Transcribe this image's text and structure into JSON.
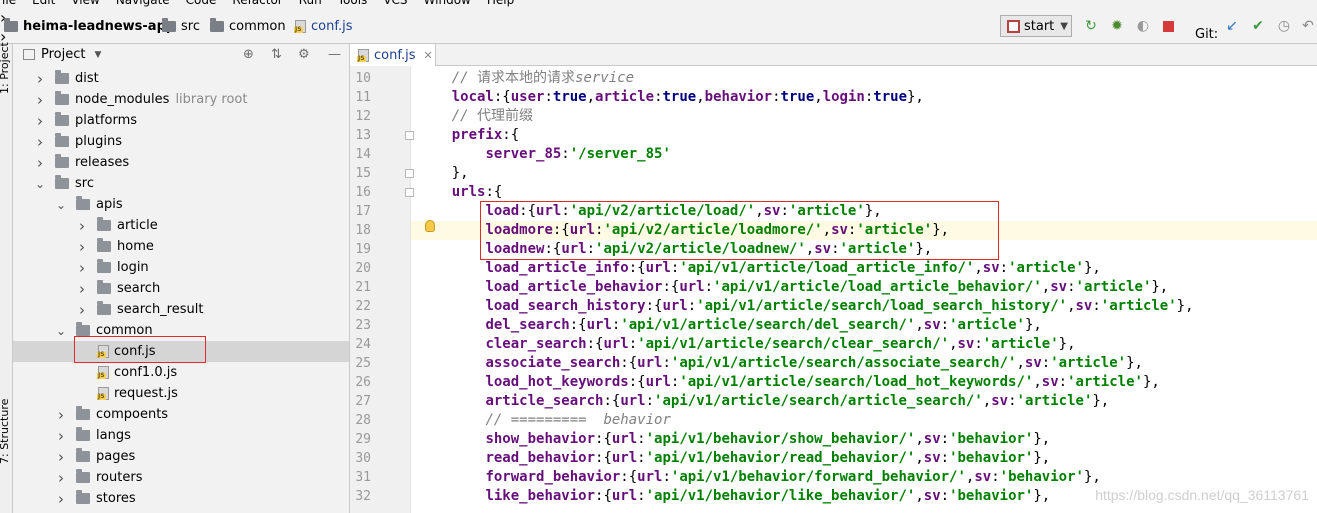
{
  "menu": [
    "File",
    "Edit",
    "View",
    "Navigate",
    "Code",
    "Refactor",
    "Run",
    "Tools",
    "VCS",
    "Window",
    "Help"
  ],
  "breadcrumb": {
    "project": "heima-leadnews-app",
    "src": "src",
    "common": "common",
    "file": "conf.js"
  },
  "toolbar": {
    "run_config": "start",
    "git_label": "Git:",
    "icons": [
      "npm-icon",
      "chevron-down-icon",
      "rerun-icon",
      "debug-icon",
      "coverage-icon",
      "stop-icon",
      "git-update-icon",
      "git-commit-icon",
      "history-icon",
      "revert-icon"
    ]
  },
  "stripe": {
    "project_label": "1: Project",
    "structure_label": "7: Structure"
  },
  "project_panel": {
    "title": "Project",
    "tree": [
      {
        "label": "dist",
        "type": "folder",
        "expanded": false
      },
      {
        "label": "node_modules",
        "hint": "library root",
        "type": "folder",
        "expanded": false
      },
      {
        "label": "platforms",
        "type": "folder",
        "expanded": false
      },
      {
        "label": "plugins",
        "type": "folder",
        "expanded": false
      },
      {
        "label": "releases",
        "type": "folder",
        "expanded": false
      },
      {
        "label": "src",
        "type": "folder",
        "expanded": true
      },
      {
        "label": "apis",
        "type": "folder",
        "expanded": true
      },
      {
        "label": "article",
        "type": "folder",
        "expanded": false
      },
      {
        "label": "home",
        "type": "folder",
        "expanded": false
      },
      {
        "label": "login",
        "type": "folder",
        "expanded": false
      },
      {
        "label": "search",
        "type": "folder",
        "expanded": false
      },
      {
        "label": "search_result",
        "type": "folder",
        "expanded": false
      },
      {
        "label": "common",
        "type": "folder",
        "expanded": true
      },
      {
        "label": "conf.js",
        "type": "file",
        "selected": true
      },
      {
        "label": "conf1.0.js",
        "type": "file"
      },
      {
        "label": "request.js",
        "type": "file"
      },
      {
        "label": "compoents",
        "type": "folder",
        "expanded": false
      },
      {
        "label": "langs",
        "type": "folder",
        "expanded": false
      },
      {
        "label": "pages",
        "type": "folder",
        "expanded": false
      },
      {
        "label": "routers",
        "type": "folder",
        "expanded": false
      },
      {
        "label": "stores",
        "type": "folder",
        "expanded": false
      }
    ]
  },
  "editor": {
    "tab": "conf.js",
    "highlighted_line": 18,
    "lines": [
      {
        "n": "10",
        "tokens": [
          [
            "cm",
            "// "
          ],
          [
            "cjk",
            "请求本地的请求"
          ],
          [
            "cm",
            "service"
          ]
        ]
      },
      {
        "n": "11",
        "tokens": [
          [
            "key",
            "local"
          ],
          [
            "p",
            ":{"
          ],
          [
            "key",
            "user"
          ],
          [
            "p",
            ":"
          ],
          [
            "kw",
            "true"
          ],
          [
            "p",
            ","
          ],
          [
            "key",
            "article"
          ],
          [
            "p",
            ":"
          ],
          [
            "kw",
            "true"
          ],
          [
            "p",
            ","
          ],
          [
            "key",
            "behavior"
          ],
          [
            "p",
            ":"
          ],
          [
            "kw",
            "true"
          ],
          [
            "p",
            ","
          ],
          [
            "key",
            "login"
          ],
          [
            "p",
            ":"
          ],
          [
            "kw",
            "true"
          ],
          [
            "p",
            "},"
          ]
        ]
      },
      {
        "n": "12",
        "tokens": [
          [
            "cm",
            "// "
          ],
          [
            "cjk",
            "代理前缀"
          ]
        ]
      },
      {
        "n": "13",
        "tokens": [
          [
            "key",
            "prefix"
          ],
          [
            "p",
            ":{"
          ]
        ]
      },
      {
        "n": "14",
        "tokens": [
          [
            "p",
            "    "
          ],
          [
            "key",
            "server_85"
          ],
          [
            "p",
            ":"
          ],
          [
            "str",
            "'/server_85'"
          ]
        ]
      },
      {
        "n": "15",
        "tokens": [
          [
            "p",
            "},"
          ]
        ]
      },
      {
        "n": "16",
        "tokens": [
          [
            "key",
            "urls"
          ],
          [
            "p",
            ":{"
          ]
        ]
      },
      {
        "n": "17",
        "tokens": [
          [
            "p",
            "    "
          ],
          [
            "key",
            "load"
          ],
          [
            "p",
            ":{"
          ],
          [
            "key",
            "url"
          ],
          [
            "p",
            ":"
          ],
          [
            "str",
            "'api/v2/article/load/'"
          ],
          [
            "p",
            ","
          ],
          [
            "key",
            "sv"
          ],
          [
            "p",
            ":"
          ],
          [
            "str",
            "'article'"
          ],
          [
            "p",
            "},"
          ]
        ]
      },
      {
        "n": "18",
        "tokens": [
          [
            "p",
            "    "
          ],
          [
            "key",
            "loadmore"
          ],
          [
            "p",
            ":{"
          ],
          [
            "key",
            "url"
          ],
          [
            "p",
            ":"
          ],
          [
            "str",
            "'api/v2/article/loadmore/'"
          ],
          [
            "p",
            ","
          ],
          [
            "key",
            "sv"
          ],
          [
            "p",
            ":"
          ],
          [
            "str",
            "'article'"
          ],
          [
            "p",
            "},"
          ]
        ]
      },
      {
        "n": "19",
        "tokens": [
          [
            "p",
            "    "
          ],
          [
            "key",
            "loadnew"
          ],
          [
            "p",
            ":{"
          ],
          [
            "key",
            "url"
          ],
          [
            "p",
            ":"
          ],
          [
            "str",
            "'api/v2/article/loadnew/'"
          ],
          [
            "p",
            ","
          ],
          [
            "key",
            "sv"
          ],
          [
            "p",
            ":"
          ],
          [
            "str",
            "'article'"
          ],
          [
            "p",
            "},"
          ]
        ]
      },
      {
        "n": "20",
        "tokens": [
          [
            "p",
            "    "
          ],
          [
            "key",
            "load_article_info"
          ],
          [
            "p",
            ":{"
          ],
          [
            "key",
            "url"
          ],
          [
            "p",
            ":"
          ],
          [
            "str",
            "'api/v1/article/load_article_info/'"
          ],
          [
            "p",
            ","
          ],
          [
            "key",
            "sv"
          ],
          [
            "p",
            ":"
          ],
          [
            "str",
            "'article'"
          ],
          [
            "p",
            "},"
          ]
        ]
      },
      {
        "n": "21",
        "tokens": [
          [
            "p",
            "    "
          ],
          [
            "key",
            "load_article_behavior"
          ],
          [
            "p",
            ":{"
          ],
          [
            "key",
            "url"
          ],
          [
            "p",
            ":"
          ],
          [
            "str",
            "'api/v1/article/load_article_behavior/'"
          ],
          [
            "p",
            ","
          ],
          [
            "key",
            "sv"
          ],
          [
            "p",
            ":"
          ],
          [
            "str",
            "'article'"
          ],
          [
            "p",
            "},"
          ]
        ]
      },
      {
        "n": "22",
        "tokens": [
          [
            "p",
            "    "
          ],
          [
            "key",
            "load_search_history"
          ],
          [
            "p",
            ":{"
          ],
          [
            "key",
            "url"
          ],
          [
            "p",
            ":"
          ],
          [
            "str",
            "'api/v1/article/search/load_search_history/'"
          ],
          [
            "p",
            ","
          ],
          [
            "key",
            "sv"
          ],
          [
            "p",
            ":"
          ],
          [
            "str",
            "'article'"
          ],
          [
            "p",
            "},"
          ]
        ]
      },
      {
        "n": "23",
        "tokens": [
          [
            "p",
            "    "
          ],
          [
            "key",
            "del_search"
          ],
          [
            "p",
            ":{"
          ],
          [
            "key",
            "url"
          ],
          [
            "p",
            ":"
          ],
          [
            "str",
            "'api/v1/article/search/del_search/'"
          ],
          [
            "p",
            ","
          ],
          [
            "key",
            "sv"
          ],
          [
            "p",
            ":"
          ],
          [
            "str",
            "'article'"
          ],
          [
            "p",
            "},"
          ]
        ]
      },
      {
        "n": "24",
        "tokens": [
          [
            "p",
            "    "
          ],
          [
            "key",
            "clear_search"
          ],
          [
            "p",
            ":{"
          ],
          [
            "key",
            "url"
          ],
          [
            "p",
            ":"
          ],
          [
            "str",
            "'api/v1/article/search/clear_search/'"
          ],
          [
            "p",
            ","
          ],
          [
            "key",
            "sv"
          ],
          [
            "p",
            ":"
          ],
          [
            "str",
            "'article'"
          ],
          [
            "p",
            "},"
          ]
        ]
      },
      {
        "n": "25",
        "tokens": [
          [
            "p",
            "    "
          ],
          [
            "key",
            "associate_search"
          ],
          [
            "p",
            ":{"
          ],
          [
            "key",
            "url"
          ],
          [
            "p",
            ":"
          ],
          [
            "str",
            "'api/v1/article/search/associate_search/'"
          ],
          [
            "p",
            ","
          ],
          [
            "key",
            "sv"
          ],
          [
            "p",
            ":"
          ],
          [
            "str",
            "'article'"
          ],
          [
            "p",
            "},"
          ]
        ]
      },
      {
        "n": "26",
        "tokens": [
          [
            "p",
            "    "
          ],
          [
            "key",
            "load_hot_keywords"
          ],
          [
            "p",
            ":{"
          ],
          [
            "key",
            "url"
          ],
          [
            "p",
            ":"
          ],
          [
            "str",
            "'api/v1/article/search/load_hot_keywords/'"
          ],
          [
            "p",
            ","
          ],
          [
            "key",
            "sv"
          ],
          [
            "p",
            ":"
          ],
          [
            "str",
            "'article'"
          ],
          [
            "p",
            "},"
          ]
        ]
      },
      {
        "n": "27",
        "tokens": [
          [
            "p",
            "    "
          ],
          [
            "key",
            "article_search"
          ],
          [
            "p",
            ":{"
          ],
          [
            "key",
            "url"
          ],
          [
            "p",
            ":"
          ],
          [
            "str",
            "'api/v1/article/search/article_search/'"
          ],
          [
            "p",
            ","
          ],
          [
            "key",
            "sv"
          ],
          [
            "p",
            ":"
          ],
          [
            "str",
            "'article'"
          ],
          [
            "p",
            "},"
          ]
        ]
      },
      {
        "n": "28",
        "tokens": [
          [
            "p",
            "    "
          ],
          [
            "cm",
            "// =========  behavior"
          ]
        ]
      },
      {
        "n": "29",
        "tokens": [
          [
            "p",
            "    "
          ],
          [
            "key",
            "show_behavior"
          ],
          [
            "p",
            ":{"
          ],
          [
            "key",
            "url"
          ],
          [
            "p",
            ":"
          ],
          [
            "str",
            "'api/v1/behavior/show_behavior/'"
          ],
          [
            "p",
            ","
          ],
          [
            "key",
            "sv"
          ],
          [
            "p",
            ":"
          ],
          [
            "str",
            "'behavior'"
          ],
          [
            "p",
            "},"
          ]
        ]
      },
      {
        "n": "30",
        "tokens": [
          [
            "p",
            "    "
          ],
          [
            "key",
            "read_behavior"
          ],
          [
            "p",
            ":{"
          ],
          [
            "key",
            "url"
          ],
          [
            "p",
            ":"
          ],
          [
            "str",
            "'api/v1/behavior/read_behavior/'"
          ],
          [
            "p",
            ","
          ],
          [
            "key",
            "sv"
          ],
          [
            "p",
            ":"
          ],
          [
            "str",
            "'behavior'"
          ],
          [
            "p",
            "},"
          ]
        ]
      },
      {
        "n": "31",
        "tokens": [
          [
            "p",
            "    "
          ],
          [
            "key",
            "forward_behavior"
          ],
          [
            "p",
            ":{"
          ],
          [
            "key",
            "url"
          ],
          [
            "p",
            ":"
          ],
          [
            "str",
            "'api/v1/behavior/forward_behavior/'"
          ],
          [
            "p",
            ","
          ],
          [
            "key",
            "sv"
          ],
          [
            "p",
            ":"
          ],
          [
            "str",
            "'behavior'"
          ],
          [
            "p",
            "},"
          ]
        ]
      },
      {
        "n": "32",
        "tokens": [
          [
            "p",
            "    "
          ],
          [
            "key",
            "like_behavior"
          ],
          [
            "p",
            ":{"
          ],
          [
            "key",
            "url"
          ],
          [
            "p",
            ":"
          ],
          [
            "str",
            "'api/v1/behavior/like_behavior/'"
          ],
          [
            "p",
            ","
          ],
          [
            "key",
            "sv"
          ],
          [
            "p",
            ":"
          ],
          [
            "str",
            "'behavior'"
          ],
          [
            "p",
            "},"
          ]
        ]
      }
    ]
  },
  "watermark": "https://blog.csdn.net/qq_36113761"
}
